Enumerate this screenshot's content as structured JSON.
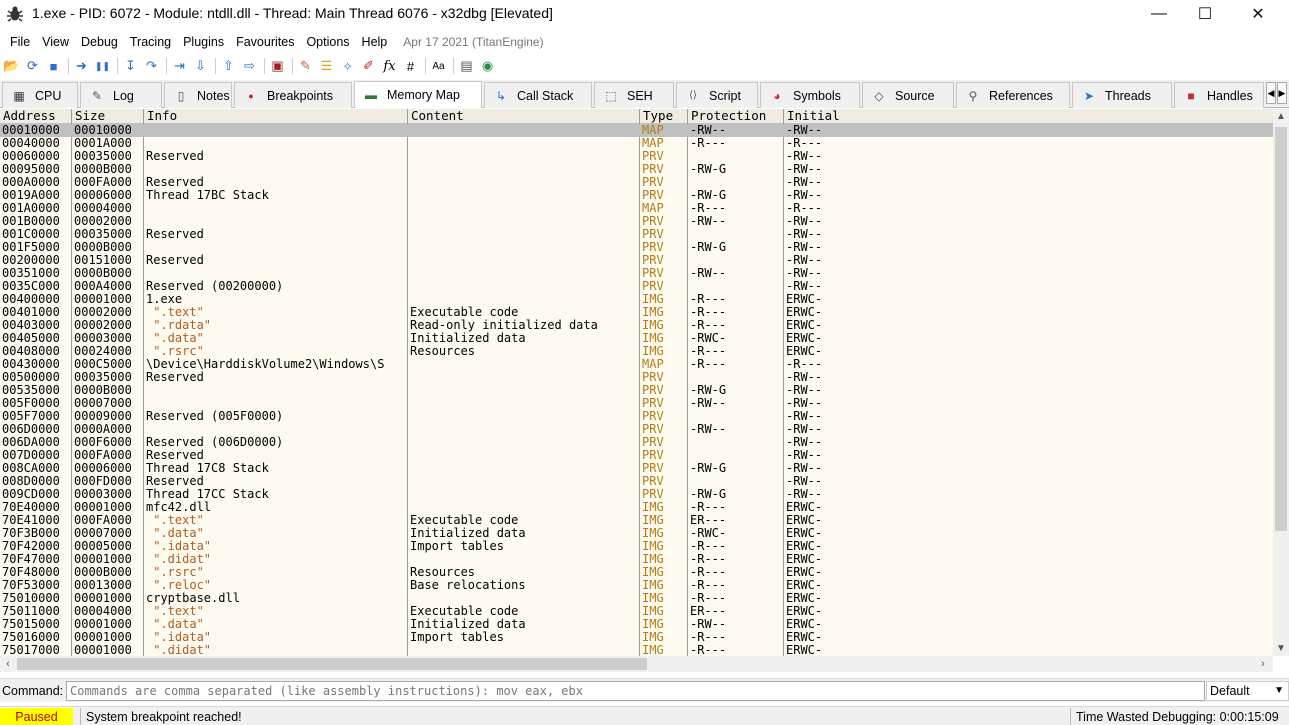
{
  "window": {
    "title": "1.exe - PID: 6072 - Module: ntdll.dll - Thread: Main Thread 6076 - x32dbg [Elevated]",
    "controls": {
      "minimize": "—",
      "maximize": "☐",
      "close": "✕"
    }
  },
  "menu": {
    "items": [
      "File",
      "View",
      "Debug",
      "Tracing",
      "Plugins",
      "Favourites",
      "Options",
      "Help"
    ],
    "build_info": "Apr 17 2021 (TitanEngine)"
  },
  "toolbar": {
    "icons": [
      {
        "name": "open-icon",
        "glyph": "📂"
      },
      {
        "name": "restart-icon",
        "glyph": "⟳"
      },
      {
        "name": "stop-icon",
        "glyph": "■"
      },
      {
        "name": "run-icon",
        "glyph": "➜"
      },
      {
        "name": "pause-icon",
        "glyph": "❚❚"
      },
      {
        "name": "step-into-icon",
        "glyph": "↧"
      },
      {
        "name": "step-over-icon",
        "glyph": "↷"
      },
      {
        "name": "trace-into-icon",
        "glyph": "⇥"
      },
      {
        "name": "trace-over-icon",
        "glyph": "⇩"
      },
      {
        "name": "execute-till-return-icon",
        "glyph": "⇧"
      },
      {
        "name": "run-to-user-code-icon",
        "glyph": "⇨"
      },
      {
        "name": "scylla-icon",
        "glyph": "▣"
      },
      {
        "name": "patch-icon",
        "glyph": "✎"
      },
      {
        "name": "comments-icon",
        "glyph": "☰"
      },
      {
        "name": "labels-icon",
        "glyph": "⟡"
      },
      {
        "name": "bookmarks-icon",
        "glyph": "✐"
      },
      {
        "name": "function-icon",
        "glyph": "fx"
      },
      {
        "name": "hash-icon",
        "glyph": "#"
      },
      {
        "name": "font-size-icon",
        "glyph": "Aa"
      },
      {
        "name": "calculator-icon",
        "glyph": "▤"
      },
      {
        "name": "globe-icon",
        "glyph": "◉"
      }
    ]
  },
  "tabs": [
    {
      "label": "CPU",
      "icon": "cpu-icon",
      "glyph": "▦"
    },
    {
      "label": "Log",
      "icon": "log-icon",
      "glyph": "✎"
    },
    {
      "label": "Notes",
      "icon": "notes-icon",
      "glyph": "▯"
    },
    {
      "label": "Breakpoints",
      "icon": "breakpoint-icon",
      "glyph": "●"
    },
    {
      "label": "Memory Map",
      "icon": "memory-map-icon",
      "glyph": "▬"
    },
    {
      "label": "Call Stack",
      "icon": "call-stack-icon",
      "glyph": "↳"
    },
    {
      "label": "SEH",
      "icon": "seh-icon",
      "glyph": "⬚"
    },
    {
      "label": "Script",
      "icon": "script-icon",
      "glyph": "⟨⟩"
    },
    {
      "label": "Symbols",
      "icon": "symbols-icon",
      "glyph": "◕"
    },
    {
      "label": "Source",
      "icon": "source-icon",
      "glyph": "◇"
    },
    {
      "label": "References",
      "icon": "references-icon",
      "glyph": "⚲"
    },
    {
      "label": "Threads",
      "icon": "threads-icon",
      "glyph": "➤"
    },
    {
      "label": "Handles",
      "icon": "handles-icon",
      "glyph": "■"
    }
  ],
  "active_tab": "Memory Map",
  "table": {
    "columns": [
      "Address",
      "Size",
      "Info",
      "Content",
      "Type",
      "Protection",
      "Initial"
    ],
    "rows": [
      [
        "00010000",
        "00010000",
        "",
        "",
        "MAP",
        "-RW--",
        "-RW--"
      ],
      [
        "00040000",
        "0001A000",
        "",
        "",
        "MAP",
        "-R---",
        "-R---"
      ],
      [
        "00060000",
        "00035000",
        "Reserved",
        "",
        "PRV",
        "",
        "-RW--"
      ],
      [
        "00095000",
        "0000B000",
        "",
        "",
        "PRV",
        "-RW-G",
        "-RW--"
      ],
      [
        "000A0000",
        "000FA000",
        "Reserved",
        "",
        "PRV",
        "",
        "-RW--"
      ],
      [
        "0019A000",
        "00006000",
        "Thread 17BC Stack",
        "",
        "PRV",
        "-RW-G",
        "-RW--"
      ],
      [
        "001A0000",
        "00004000",
        "",
        "",
        "MAP",
        "-R---",
        "-R---"
      ],
      [
        "001B0000",
        "00002000",
        "",
        "",
        "PRV",
        "-RW--",
        "-RW--"
      ],
      [
        "001C0000",
        "00035000",
        "Reserved",
        "",
        "PRV",
        "",
        "-RW--"
      ],
      [
        "001F5000",
        "0000B000",
        "",
        "",
        "PRV",
        "-RW-G",
        "-RW--"
      ],
      [
        "00200000",
        "00151000",
        "Reserved",
        "",
        "PRV",
        "",
        "-RW--"
      ],
      [
        "00351000",
        "0000B000",
        "",
        "",
        "PRV",
        "-RW--",
        "-RW--"
      ],
      [
        "0035C000",
        "000A4000",
        "Reserved (00200000)",
        "",
        "PRV",
        "",
        "-RW--"
      ],
      [
        "00400000",
        "00001000",
        "1.exe",
        "",
        "IMG",
        "-R---",
        "ERWC-"
      ],
      [
        "00401000",
        "00002000",
        " \".text\"",
        "Executable code",
        "IMG",
        "-R---",
        "ERWC-"
      ],
      [
        "00403000",
        "00002000",
        " \".rdata\"",
        "Read-only initialized data",
        "IMG",
        "-R---",
        "ERWC-"
      ],
      [
        "00405000",
        "00003000",
        " \".data\"",
        "Initialized data",
        "IMG",
        "-RWC-",
        "ERWC-"
      ],
      [
        "00408000",
        "00024000",
        " \".rsrc\"",
        "Resources",
        "IMG",
        "-R---",
        "ERWC-"
      ],
      [
        "00430000",
        "000C5000",
        "\\Device\\HarddiskVolume2\\Windows\\S",
        "",
        "MAP",
        "-R---",
        "-R---"
      ],
      [
        "00500000",
        "00035000",
        "Reserved",
        "",
        "PRV",
        "",
        "-RW--"
      ],
      [
        "00535000",
        "0000B000",
        "",
        "",
        "PRV",
        "-RW-G",
        "-RW--"
      ],
      [
        "005F0000",
        "00007000",
        "",
        "",
        "PRV",
        "-RW--",
        "-RW--"
      ],
      [
        "005F7000",
        "00009000",
        "Reserved (005F0000)",
        "",
        "PRV",
        "",
        "-RW--"
      ],
      [
        "006D0000",
        "0000A000",
        "",
        "",
        "PRV",
        "-RW--",
        "-RW--"
      ],
      [
        "006DA000",
        "000F6000",
        "Reserved (006D0000)",
        "",
        "PRV",
        "",
        "-RW--"
      ],
      [
        "007D0000",
        "000FA000",
        "Reserved",
        "",
        "PRV",
        "",
        "-RW--"
      ],
      [
        "008CA000",
        "00006000",
        "Thread 17C8 Stack",
        "",
        "PRV",
        "-RW-G",
        "-RW--"
      ],
      [
        "008D0000",
        "000FD000",
        "Reserved",
        "",
        "PRV",
        "",
        "-RW--"
      ],
      [
        "009CD000",
        "00003000",
        "Thread 17CC Stack",
        "",
        "PRV",
        "-RW-G",
        "-RW--"
      ],
      [
        "70E40000",
        "00001000",
        "mfc42.dll",
        "",
        "IMG",
        "-R---",
        "ERWC-"
      ],
      [
        "70E41000",
        "000FA000",
        " \".text\"",
        "Executable code",
        "IMG",
        "ER---",
        "ERWC-"
      ],
      [
        "70F3B000",
        "00007000",
        " \".data\"",
        "Initialized data",
        "IMG",
        "-RWC-",
        "ERWC-"
      ],
      [
        "70F42000",
        "00005000",
        " \".idata\"",
        "Import tables",
        "IMG",
        "-R---",
        "ERWC-"
      ],
      [
        "70F47000",
        "00001000",
        " \".didat\"",
        "",
        "IMG",
        "-R---",
        "ERWC-"
      ],
      [
        "70F48000",
        "0000B000",
        " \".rsrc\"",
        "Resources",
        "IMG",
        "-R---",
        "ERWC-"
      ],
      [
        "70F53000",
        "00013000",
        " \".reloc\"",
        "Base relocations",
        "IMG",
        "-R---",
        "ERWC-"
      ],
      [
        "75010000",
        "00001000",
        "cryptbase.dll",
        "",
        "IMG",
        "-R---",
        "ERWC-"
      ],
      [
        "75011000",
        "00004000",
        " \".text\"",
        "Executable code",
        "IMG",
        "ER---",
        "ERWC-"
      ],
      [
        "75015000",
        "00001000",
        " \".data\"",
        "Initialized data",
        "IMG",
        "-RW--",
        "ERWC-"
      ],
      [
        "75016000",
        "00001000",
        " \".idata\"",
        "Import tables",
        "IMG",
        "-R---",
        "ERWC-"
      ],
      [
        "75017000",
        "00001000",
        " \".didat\"",
        "",
        "IMG",
        "-R---",
        "ERWC-"
      ]
    ],
    "selected_row": 0
  },
  "command": {
    "label": "Command:",
    "placeholder": "Commands are comma separated (like assembly instructions): mov eax, ebx",
    "mode": "Default"
  },
  "status": {
    "state": "Paused",
    "message": "System breakpoint reached!",
    "time_wasted": "Time Wasted Debugging: 0:00:15:09"
  },
  "colors": {
    "row_background": "#fffaf0",
    "selected_row": "#c0c0c0",
    "type_text": "#b07d16",
    "section_text": "#b05e1e",
    "paused_background": "#ffff00",
    "paused_text": "#c00000"
  }
}
